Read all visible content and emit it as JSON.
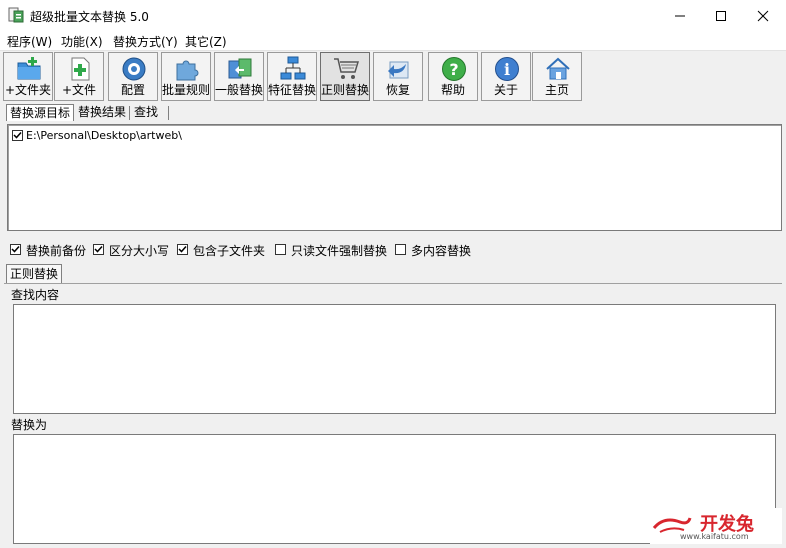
{
  "window": {
    "title": "超级批量文本替换 5.0",
    "minimize": "—",
    "maximize": "☐",
    "close": "✕"
  },
  "menu": [
    "程序(W)",
    "功能(X)",
    "替换方式(Y)",
    "其它(Z)"
  ],
  "toolbar": [
    {
      "label": "+文件夹",
      "icon": "folder-add-icon"
    },
    {
      "label": "+文件",
      "icon": "file-add-icon"
    },
    {
      "label": "配置",
      "icon": "config-gear-icon"
    },
    {
      "label": "批量规则",
      "icon": "puzzle-icon"
    },
    {
      "label": "一般替换",
      "icon": "swap-icon"
    },
    {
      "label": "特征替换",
      "icon": "network-icon"
    },
    {
      "label": "正则替换",
      "icon": "cart-icon",
      "active": true
    },
    {
      "label": "恢复",
      "icon": "restore-arrow-icon"
    },
    {
      "label": "帮助",
      "icon": "help-icon"
    },
    {
      "label": "关于",
      "icon": "info-icon"
    },
    {
      "label": "主页",
      "icon": "home-icon"
    }
  ],
  "source_tabs": [
    "替换源目标",
    "替换结果",
    "查找"
  ],
  "source_items": [
    {
      "checked": true,
      "path": "E:\\Personal\\Desktop\\artweb\\"
    }
  ],
  "options": [
    {
      "label": "替换前备份",
      "checked": true
    },
    {
      "label": "区分大小写",
      "checked": true
    },
    {
      "label": "包含子文件夹",
      "checked": true
    },
    {
      "label": "只读文件强制替换",
      "checked": false
    },
    {
      "label": "多内容替换",
      "checked": false
    }
  ],
  "mode_tab": "正则替换",
  "find": {
    "label": "查找内容",
    "value": ""
  },
  "replace": {
    "label": "替换为",
    "value": ""
  },
  "watermark": {
    "brand": "开发兔",
    "url": "www.kaifatu.com"
  },
  "colors": {
    "accent_red": "#d8262e",
    "window_bg": "#f0f0f0"
  }
}
